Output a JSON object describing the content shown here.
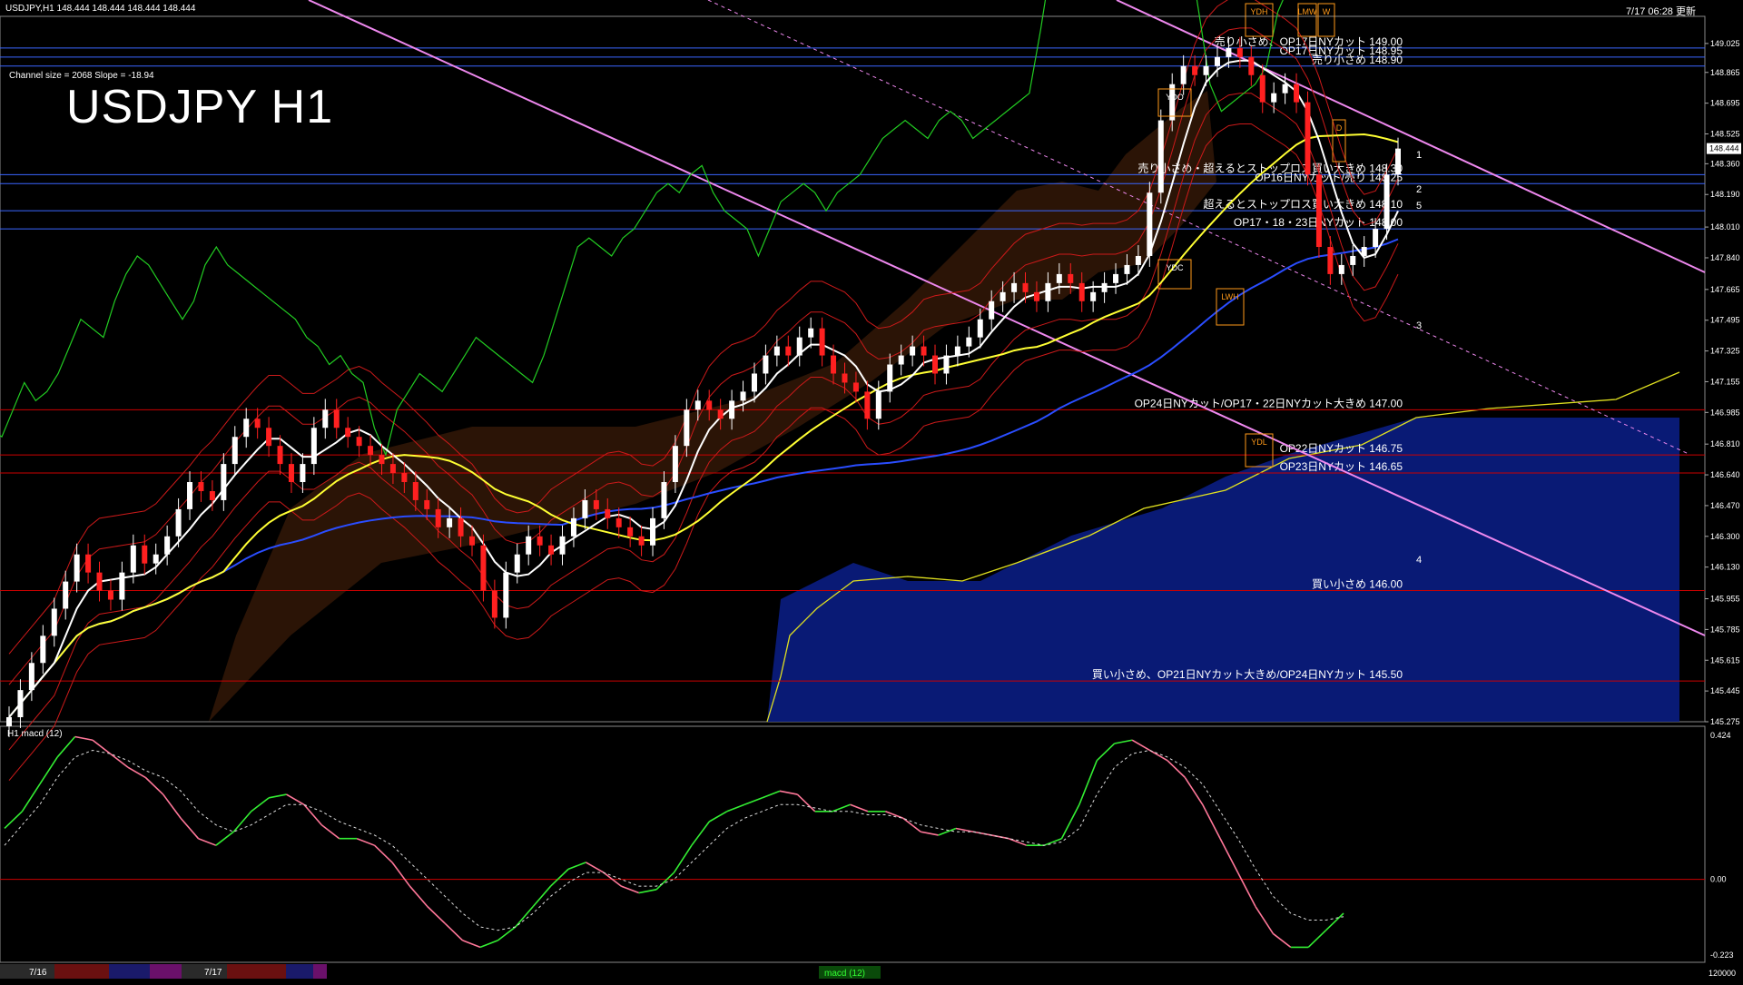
{
  "header": {
    "symbol_line": "USDJPY,H1  148.444 148.444 148.444 148.444",
    "timestamp": "7/17 06:28 更新",
    "channel_info": "Channel size = 2068 Slope = -18.94",
    "big_title": "USDJPY H1"
  },
  "colors": {
    "background": "#000000",
    "candle_up": "#ffffff",
    "candle_down": "#ff2020",
    "ma_fast": "#ffffff",
    "ma_mid": "#ffff33",
    "ma_slow": "#2a4dff",
    "bollinger": "#cc1a1a",
    "chikou": "#22cc22",
    "channel": "#ee88ee",
    "macd_up": "#33ee33",
    "macd_down": "#ff7799",
    "signal": "#dddddd",
    "level_line": "#cc0000",
    "blue_line": "#3a66ff"
  },
  "chart_data": [
    {
      "type": "candlestick",
      "title": "USDJPY H1",
      "price_axis": [
        "149.025",
        "148.865",
        "148.695",
        "148.525",
        "148.360",
        "148.190",
        "148.010",
        "147.840",
        "147.665",
        "147.495",
        "147.325",
        "147.155",
        "146.985",
        "146.810",
        "146.640",
        "146.470",
        "146.300",
        "146.130",
        "145.955",
        "145.785",
        "145.615",
        "145.445",
        "145.275"
      ],
      "ylim": [
        145.275,
        149.175
      ],
      "current_price": "148.444",
      "ohlc_close": [
        145.3,
        145.45,
        145.6,
        145.75,
        145.9,
        146.05,
        146.2,
        146.1,
        146.0,
        145.95,
        146.1,
        146.25,
        146.15,
        146.2,
        146.3,
        146.45,
        146.6,
        146.55,
        146.5,
        146.7,
        146.85,
        146.95,
        146.9,
        146.8,
        146.7,
        146.6,
        146.7,
        146.9,
        147.0,
        146.9,
        146.85,
        146.8,
        146.75,
        146.7,
        146.65,
        146.6,
        146.5,
        146.45,
        146.35,
        146.4,
        146.3,
        146.25,
        146.0,
        145.85,
        146.1,
        146.2,
        146.3,
        146.25,
        146.2,
        146.3,
        146.4,
        146.5,
        146.45,
        146.4,
        146.35,
        146.3,
        146.25,
        146.4,
        146.6,
        146.8,
        147.0,
        147.05,
        147.0,
        146.95,
        147.05,
        147.1,
        147.2,
        147.3,
        147.35,
        147.3,
        147.4,
        147.45,
        147.3,
        147.2,
        147.15,
        147.1,
        146.95,
        147.1,
        147.25,
        147.3,
        147.35,
        147.3,
        147.2,
        147.3,
        147.35,
        147.4,
        147.5,
        147.6,
        147.65,
        147.7,
        147.65,
        147.6,
        147.7,
        147.75,
        147.7,
        147.6,
        147.65,
        147.7,
        147.75,
        147.8,
        147.85,
        148.2,
        148.6,
        148.8,
        148.9,
        148.85,
        148.9,
        148.95,
        149.0,
        148.95,
        148.85,
        148.7,
        148.75,
        148.8,
        148.7,
        148.3,
        147.9,
        147.75,
        147.8,
        147.85,
        147.9,
        148.0,
        148.3,
        148.444
      ],
      "levels": [
        {
          "price": 149.0,
          "label": "売り小さめ、OP17日NYカット 149.00"
        },
        {
          "price": 148.95,
          "label": "OP17日NYカット 148.95"
        },
        {
          "price": 148.9,
          "label": "売り小さめ 148.90"
        },
        {
          "price": 148.3,
          "label": "売り小さめ・超えるとストップロス買い大きめ 148.30"
        },
        {
          "price": 148.25,
          "label": "OP16日NYカット/売り 148.25"
        },
        {
          "price": 148.1,
          "label": "超えるとストップロス買い大きめ 148.10"
        },
        {
          "price": 148.0,
          "label": "OP17・18・23日NYカット 148.00"
        },
        {
          "price": 147.0,
          "label": "OP24日NYカット/OP17・22日NYカット大きめ 147.00"
        },
        {
          "price": 146.75,
          "label": "OP22日NYカット 146.75"
        },
        {
          "price": 146.65,
          "label": "OP23日NYカット 146.65"
        },
        {
          "price": 146.0,
          "label": "買い小さめ 146.00"
        },
        {
          "price": 145.5,
          "label": "買い小さめ、OP21日NYカット大きめ/OP24日NYカット 145.50"
        }
      ],
      "boxes": [
        "YDH",
        "LMW",
        "W",
        "YDO",
        "YDC",
        "LWH",
        "YDL",
        "D"
      ],
      "target_labels": [
        "1",
        "2",
        "3",
        "4",
        "5"
      ]
    },
    {
      "type": "line",
      "title": "H1  macd (12)",
      "y_axis": [
        "0.424",
        "0.00",
        "-0.223"
      ],
      "ylim": [
        -0.223,
        0.424
      ],
      "series": [
        {
          "name": "",
          "values": [
            0.15,
            0.2,
            0.28,
            0.36,
            0.42,
            0.41,
            0.37,
            0.33,
            0.3,
            0.25,
            0.18,
            0.12,
            0.1,
            0.14,
            0.2,
            0.24,
            0.25,
            0.22,
            0.16,
            0.12,
            0.12,
            0.1,
            0.05,
            -0.02,
            -0.08,
            -0.13,
            -0.18,
            -0.2,
            -0.18,
            -0.14,
            -0.08,
            -0.02,
            0.03,
            0.05,
            0.02,
            -0.02,
            -0.04,
            -0.03,
            0.02,
            0.1,
            0.17,
            0.2,
            0.22,
            0.24,
            0.26,
            0.25,
            0.2,
            0.2,
            0.22,
            0.2,
            0.2,
            0.18,
            0.14,
            0.13,
            0.15,
            0.14,
            0.13,
            0.12,
            0.1,
            0.1,
            0.12,
            0.22,
            0.35,
            0.4,
            0.41,
            0.38,
            0.35,
            0.3,
            0.22,
            0.12,
            0.02,
            -0.08,
            -0.16,
            -0.2,
            -0.2,
            -0.15,
            -0.1
          ]
        },
        {
          "name": "",
          "values": [
            0.1,
            0.16,
            0.22,
            0.3,
            0.36,
            0.38,
            0.37,
            0.35,
            0.32,
            0.3,
            0.26,
            0.2,
            0.16,
            0.14,
            0.16,
            0.19,
            0.22,
            0.22,
            0.2,
            0.17,
            0.15,
            0.13,
            0.1,
            0.05,
            0.0,
            -0.05,
            -0.1,
            -0.14,
            -0.15,
            -0.14,
            -0.1,
            -0.05,
            -0.01,
            0.02,
            0.02,
            0.0,
            -0.02,
            -0.02,
            0.0,
            0.05,
            0.1,
            0.15,
            0.18,
            0.2,
            0.22,
            0.22,
            0.21,
            0.2,
            0.2,
            0.19,
            0.19,
            0.18,
            0.16,
            0.15,
            0.14,
            0.14,
            0.13,
            0.12,
            0.11,
            0.1,
            0.11,
            0.15,
            0.25,
            0.33,
            0.37,
            0.38,
            0.36,
            0.33,
            0.28,
            0.2,
            0.12,
            0.03,
            -0.05,
            -0.1,
            -0.12,
            -0.12,
            -0.11
          ]
        }
      ]
    }
  ],
  "footer": {
    "date_left": "7/16",
    "date_mid": "7/17",
    "indicator_tag": "macd (12)",
    "volume_val": "120000"
  }
}
